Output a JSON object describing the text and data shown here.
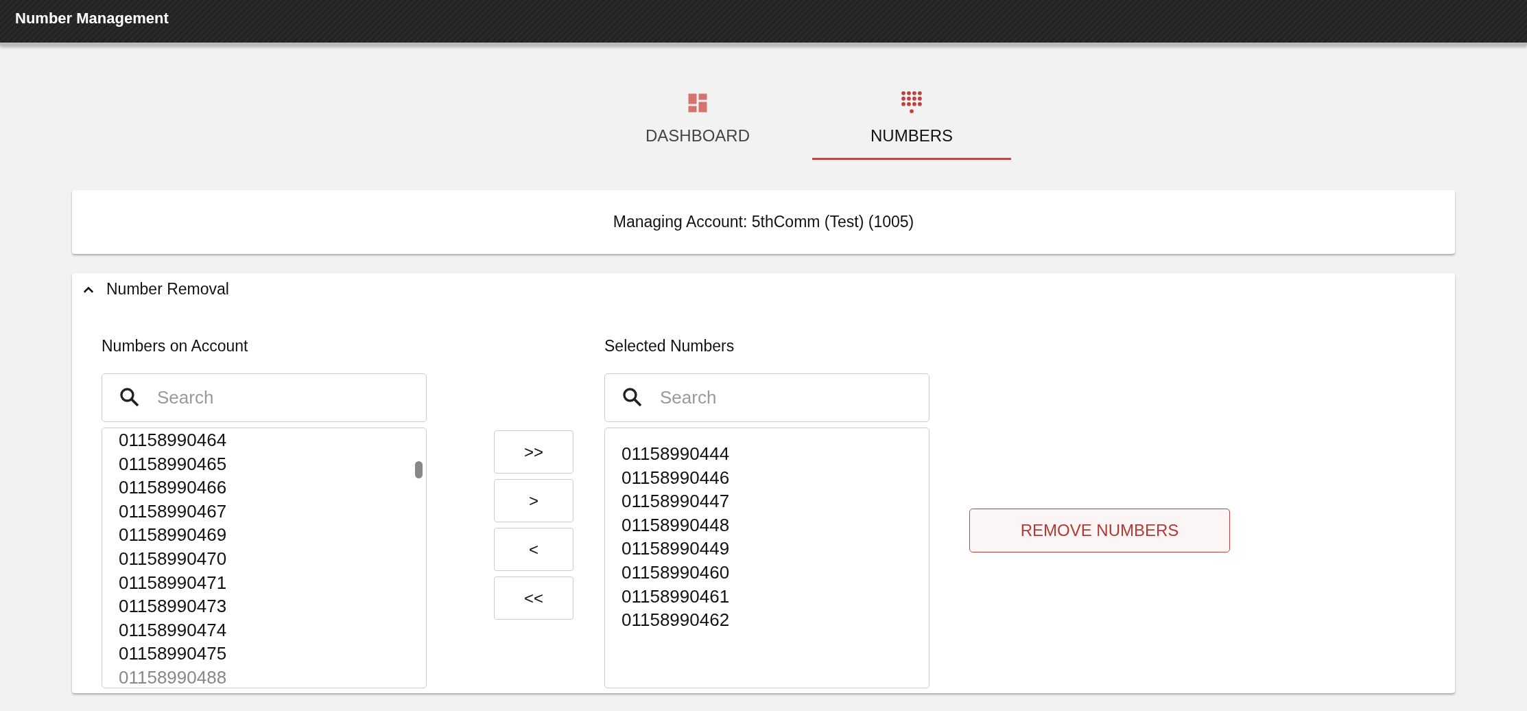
{
  "app_bar": {
    "title": "Number Management"
  },
  "tabs": [
    {
      "label": "DASHBOARD",
      "kind": "dashboard",
      "selected": false
    },
    {
      "label": "NUMBERS",
      "kind": "dialpad",
      "selected": true
    }
  ],
  "account_card": {
    "text": "Managing Account: 5thComm (Test) (1005)"
  },
  "removal_panel": {
    "title": "Number Removal",
    "expanded": true,
    "available": {
      "label": "Numbers on Account",
      "search_placeholder": "Search",
      "items": [
        {
          "number": "01158990464",
          "faded": false
        },
        {
          "number": "01158990465",
          "faded": false
        },
        {
          "number": "01158990466",
          "faded": false
        },
        {
          "number": "01158990467",
          "faded": false
        },
        {
          "number": "01158990469",
          "faded": false
        },
        {
          "number": "01158990470",
          "faded": false
        },
        {
          "number": "01158990471",
          "faded": false
        },
        {
          "number": "01158990473",
          "faded": false
        },
        {
          "number": "01158990474",
          "faded": false
        },
        {
          "number": "01158990475",
          "faded": false
        },
        {
          "number": "01158990488",
          "faded": true
        }
      ]
    },
    "transfer_buttons": [
      ">>",
      ">",
      "<",
      "<<"
    ],
    "selected": {
      "label": "Selected Numbers",
      "search_placeholder": "Search",
      "items": [
        {
          "number": "01158990444",
          "faded": false
        },
        {
          "number": "01158990446",
          "faded": false
        },
        {
          "number": "01158990447",
          "faded": false
        },
        {
          "number": "01158990448",
          "faded": false
        },
        {
          "number": "01158990449",
          "faded": false
        },
        {
          "number": "01158990460",
          "faded": false
        },
        {
          "number": "01158990461",
          "faded": false
        },
        {
          "number": "01158990462",
          "faded": false
        }
      ]
    },
    "action_button": "REMOVE NUMBERS"
  }
}
